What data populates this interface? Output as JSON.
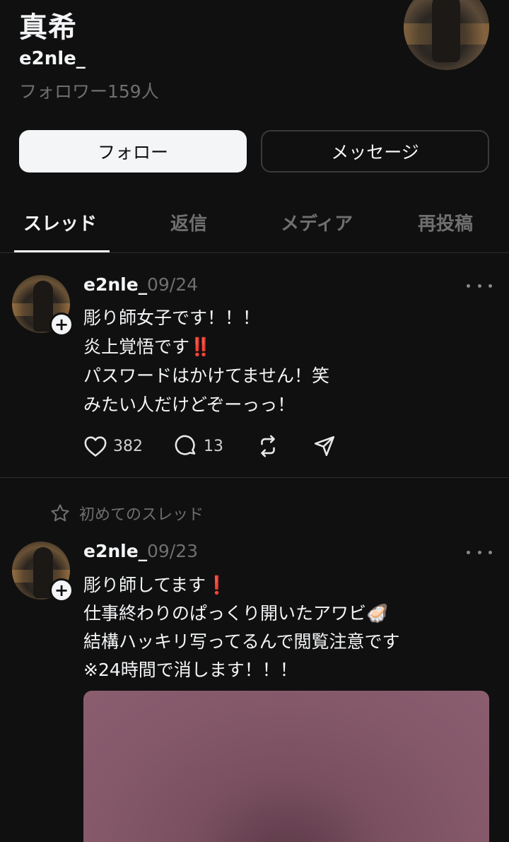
{
  "profile": {
    "name": "真希",
    "handle": "e2nle_",
    "followers": "フォロワー159人"
  },
  "buttons": {
    "follow": "フォロー",
    "message": "メッセージ"
  },
  "tabs": [
    {
      "label": "スレッド",
      "active": true
    },
    {
      "label": "返信",
      "active": false
    },
    {
      "label": "メディア",
      "active": false
    },
    {
      "label": "再投稿",
      "active": false
    }
  ],
  "posts": [
    {
      "user": "e2nle_",
      "date": "09/24",
      "lines": [
        "彫り師女子です！！！",
        "炎上覚悟です",
        "パスワードはかけてません！笑",
        "みたい人だけどぞーっっ！"
      ],
      "line2_mark": "‼️",
      "likes": "382",
      "replies": "13"
    },
    {
      "pinned_label": "初めてのスレッド",
      "user": "e2nle_",
      "date": "09/23",
      "lines": [
        "彫り師してます",
        "仕事終わりのぱっくり開いたアワビ",
        "結構ハッキリ写ってるんで閲覧注意です",
        "※24時間で消します！！！"
      ],
      "line1_mark": "❗",
      "line2_emoji": "🦪"
    }
  ],
  "colors": {
    "background": "#101010",
    "text": "#f3f5f7",
    "muted": "#6f6f6f",
    "alert": "#e0191f"
  },
  "icons": [
    "heart-icon",
    "reply-icon",
    "repost-icon",
    "share-icon",
    "more-icon",
    "star-icon",
    "plus-icon"
  ]
}
